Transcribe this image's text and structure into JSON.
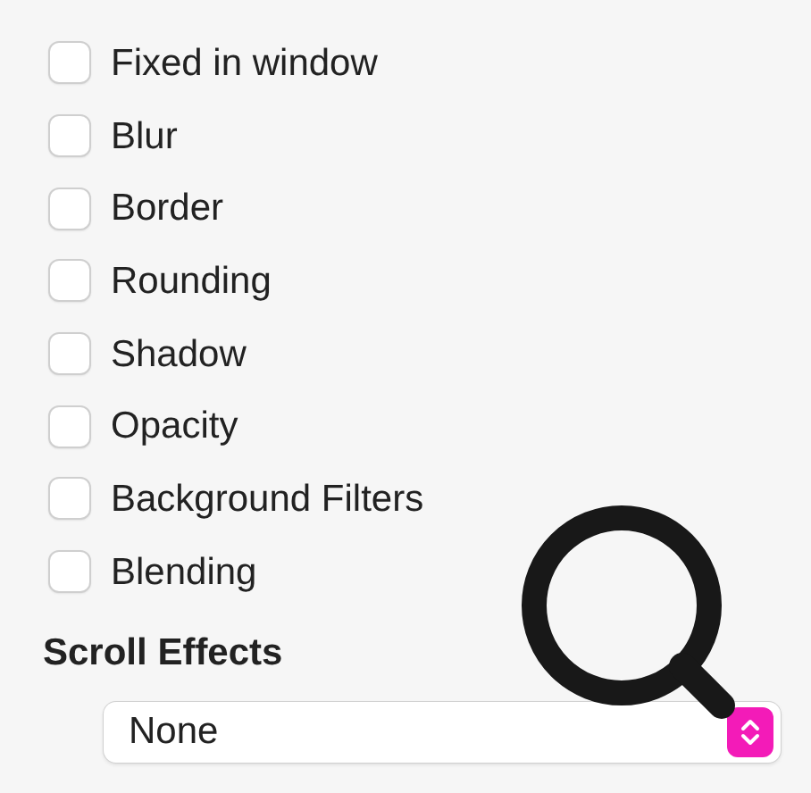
{
  "options": [
    {
      "label": "Fixed in window",
      "checked": false
    },
    {
      "label": "Blur",
      "checked": false
    },
    {
      "label": "Border",
      "checked": false
    },
    {
      "label": "Rounding",
      "checked": false
    },
    {
      "label": "Shadow",
      "checked": false
    },
    {
      "label": "Opacity",
      "checked": false
    },
    {
      "label": "Background Filters",
      "checked": false
    },
    {
      "label": "Blending",
      "checked": false
    }
  ],
  "scroll_effects": {
    "heading": "Scroll Effects",
    "value": "None"
  }
}
